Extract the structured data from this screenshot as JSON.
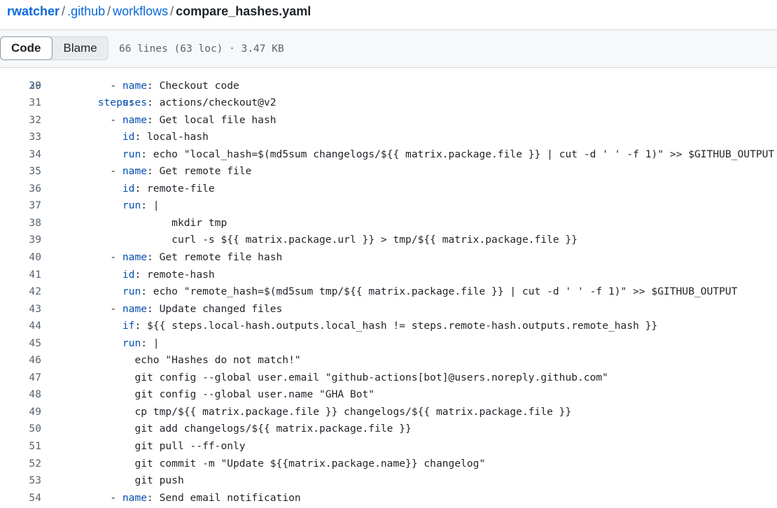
{
  "breadcrumb": {
    "owner": "rwatcher",
    "separator": "/",
    "parts": [
      ".github",
      "workflows"
    ],
    "current_file": "compare_hashes.yaml"
  },
  "toolbar": {
    "code_label": "Code",
    "blame_label": "Blame",
    "file_info": "66 lines (63 loc) · 3.47 KB"
  },
  "code": {
    "partial_line": {
      "number": "29",
      "key": "steps",
      "rest": ":"
    },
    "lines": [
      {
        "number": "30",
        "indent": "        ",
        "dash": "- ",
        "key": "name",
        "rest": ": Checkout code"
      },
      {
        "number": "31",
        "indent": "          ",
        "dash": "",
        "key": "uses",
        "rest": ": actions/checkout@v2"
      },
      {
        "number": "32",
        "indent": "        ",
        "dash": "- ",
        "key": "name",
        "rest": ": Get local file hash"
      },
      {
        "number": "33",
        "indent": "          ",
        "dash": "",
        "key": "id",
        "rest": ": local-hash"
      },
      {
        "number": "34",
        "indent": "          ",
        "dash": "",
        "key": "run",
        "rest": ": echo \"local_hash=$(md5sum changelogs/${{ matrix.package.file }} | cut -d ' ' -f 1)\" >> $GITHUB_OUTPUT"
      },
      {
        "number": "35",
        "indent": "        ",
        "dash": "- ",
        "key": "name",
        "rest": ": Get remote file"
      },
      {
        "number": "36",
        "indent": "          ",
        "dash": "",
        "key": "id",
        "rest": ": remote-file"
      },
      {
        "number": "37",
        "indent": "          ",
        "dash": "",
        "key": "run",
        "rest": ": |"
      },
      {
        "number": "38",
        "indent": "                  ",
        "dash": "",
        "key": "",
        "rest": "mkdir tmp"
      },
      {
        "number": "39",
        "indent": "                  ",
        "dash": "",
        "key": "",
        "rest": "curl -s ${{ matrix.package.url }} > tmp/${{ matrix.package.file }}"
      },
      {
        "number": "40",
        "indent": "        ",
        "dash": "- ",
        "key": "name",
        "rest": ": Get remote file hash"
      },
      {
        "number": "41",
        "indent": "          ",
        "dash": "",
        "key": "id",
        "rest": ": remote-hash"
      },
      {
        "number": "42",
        "indent": "          ",
        "dash": "",
        "key": "run",
        "rest": ": echo \"remote_hash=$(md5sum tmp/${{ matrix.package.file }} | cut -d ' ' -f 1)\" >> $GITHUB_OUTPUT"
      },
      {
        "number": "43",
        "indent": "        ",
        "dash": "- ",
        "key": "name",
        "rest": ": Update changed files"
      },
      {
        "number": "44",
        "indent": "          ",
        "dash": "",
        "key": "if",
        "rest": ": ${{ steps.local-hash.outputs.local_hash != steps.remote-hash.outputs.remote_hash }}"
      },
      {
        "number": "45",
        "indent": "          ",
        "dash": "",
        "key": "run",
        "rest": ": |"
      },
      {
        "number": "46",
        "indent": "            ",
        "dash": "",
        "key": "",
        "rest": "echo \"Hashes do not match!\""
      },
      {
        "number": "47",
        "indent": "            ",
        "dash": "",
        "key": "",
        "rest": "git config --global user.email \"github-actions[bot]@users.noreply.github.com\""
      },
      {
        "number": "48",
        "indent": "            ",
        "dash": "",
        "key": "",
        "rest": "git config --global user.name \"GHA Bot\""
      },
      {
        "number": "49",
        "indent": "            ",
        "dash": "",
        "key": "",
        "rest": "cp tmp/${{ matrix.package.file }} changelogs/${{ matrix.package.file }}"
      },
      {
        "number": "50",
        "indent": "            ",
        "dash": "",
        "key": "",
        "rest": "git add changelogs/${{ matrix.package.file }}"
      },
      {
        "number": "51",
        "indent": "            ",
        "dash": "",
        "key": "",
        "rest": "git pull --ff-only"
      },
      {
        "number": "52",
        "indent": "            ",
        "dash": "",
        "key": "",
        "rest": "git commit -m \"Update ${{matrix.package.name}} changelog\""
      },
      {
        "number": "53",
        "indent": "            ",
        "dash": "",
        "key": "",
        "rest": "git push"
      },
      {
        "number": "54",
        "indent": "        ",
        "dash": "- ",
        "key": "name",
        "rest": ": Send email notification"
      }
    ]
  }
}
